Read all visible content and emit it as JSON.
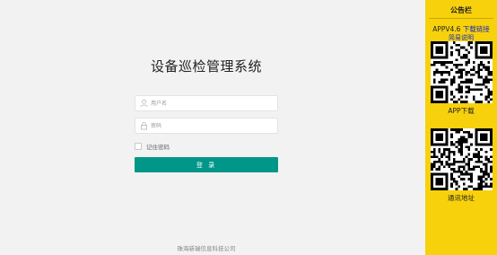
{
  "login": {
    "title": "设备巡检管理系统",
    "username_placeholder": "用户名",
    "password_placeholder": "密码",
    "remember_label": "记住密码",
    "login_button": "登 录",
    "footer": "珠海新瑞信息科技公司"
  },
  "sidebar": {
    "heading": "公告栏",
    "version_prefix": "APPV4.6 ",
    "download_link": "下载链接",
    "description_link": "简易说明",
    "app_caption": "APP下载",
    "contact_caption": "通讯地址"
  },
  "colors": {
    "primary": "#009688",
    "sidebar_bg": "#f7d10c",
    "link": "#1f2db3"
  },
  "icons": {
    "username": "user-icon",
    "password": "lock-icon",
    "app_qr": "qr-code-icon",
    "contact_qr": "qr-code-icon"
  }
}
